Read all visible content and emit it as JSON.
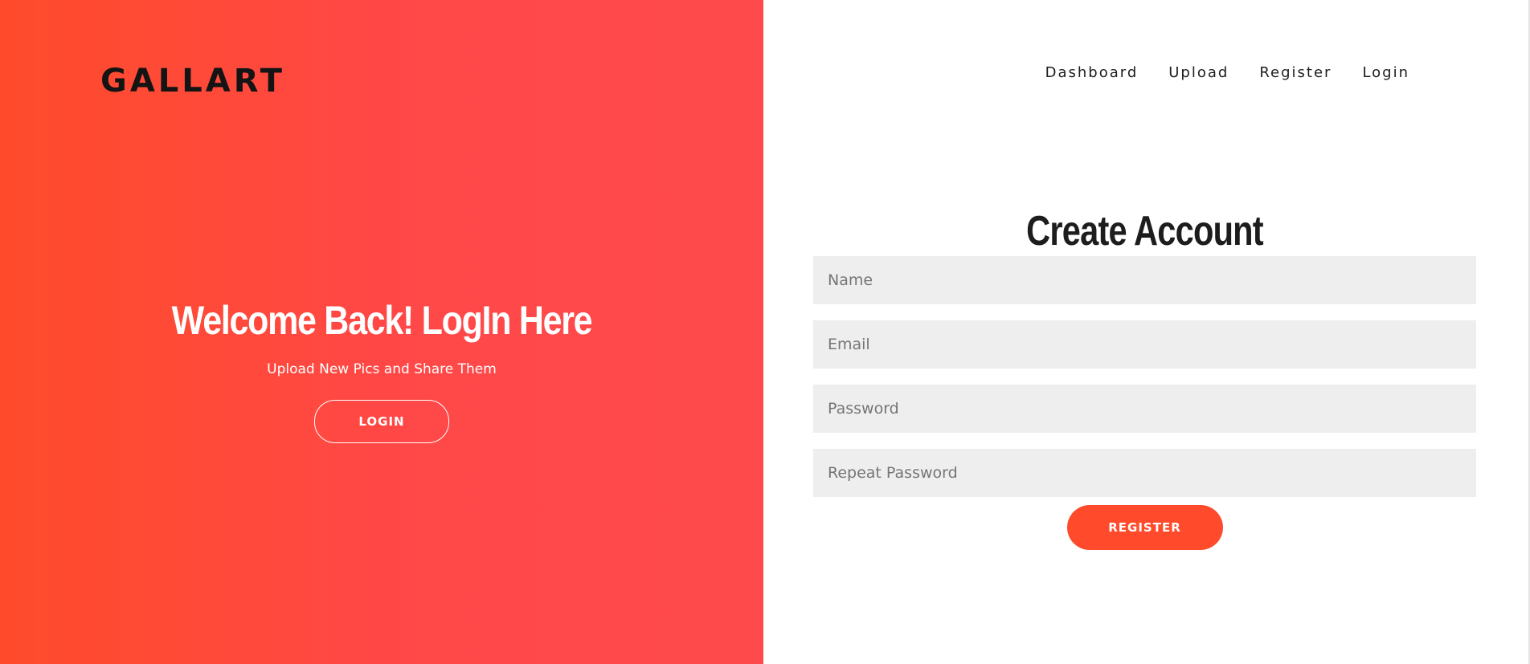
{
  "brand": {
    "name": "GALLART"
  },
  "hero": {
    "title": "Welcome Back! LogIn Here",
    "subtitle": "Upload New Pics and Share Them",
    "login_button_label": "LOGIN"
  },
  "nav": {
    "items": [
      {
        "label": "Dashboard"
      },
      {
        "label": "Upload"
      },
      {
        "label": "Register"
      },
      {
        "label": "Login"
      }
    ]
  },
  "form": {
    "title": "Create Account",
    "fields": [
      {
        "placeholder": "Name",
        "value": ""
      },
      {
        "placeholder": "Email",
        "value": ""
      },
      {
        "placeholder": "Password",
        "value": ""
      },
      {
        "placeholder": "Repeat Password",
        "value": ""
      }
    ],
    "submit_label": "REGISTER"
  },
  "colors": {
    "accent": "#ff4b2b",
    "gradient_start": "#ff4b2b",
    "gradient_end": "#ff4a4c",
    "input_background": "#eeeeee",
    "text_dark": "#1d1d1d"
  }
}
